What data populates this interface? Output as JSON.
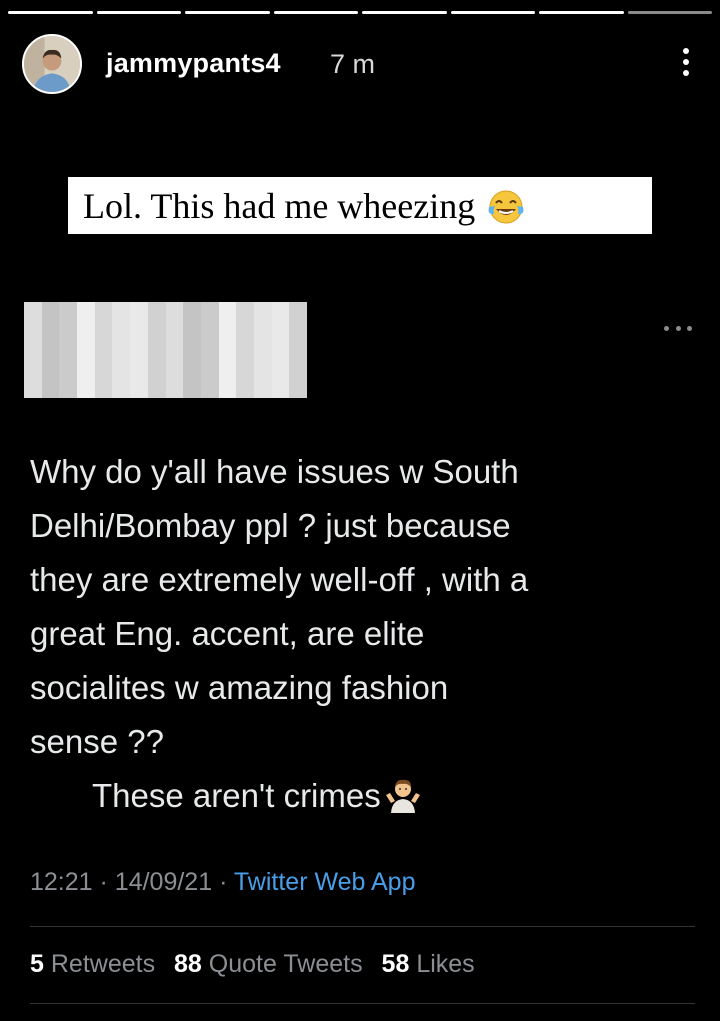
{
  "story": {
    "segments": 8,
    "username": "jammypants4",
    "time": "7 m"
  },
  "caption": {
    "text": "Lol. This had me wheezing",
    "emoji": "face-with-tears-of-joy-icon"
  },
  "tweet": {
    "lines": [
      "Why do y'all have issues w South",
      "Delhi/Bombay ppl ? just because",
      "they are extremely well-off , with a",
      "great Eng. accent, are elite",
      "socialites w amazing fashion",
      "sense ??"
    ],
    "last_line": "These aren't crimes",
    "last_emoji": "person-shrugging-icon",
    "time": "12:21",
    "date": "14/09/21",
    "separator": "·",
    "source": "Twitter Web App",
    "stats": {
      "retweets_count": "5",
      "retweets_label": "Retweets",
      "quotes_count": "88",
      "quotes_label": "Quote Tweets",
      "likes_count": "58",
      "likes_label": "Likes"
    }
  },
  "colors": {
    "background": "#000000",
    "link": "#4a9ee8",
    "muted": "#8b8f93"
  }
}
